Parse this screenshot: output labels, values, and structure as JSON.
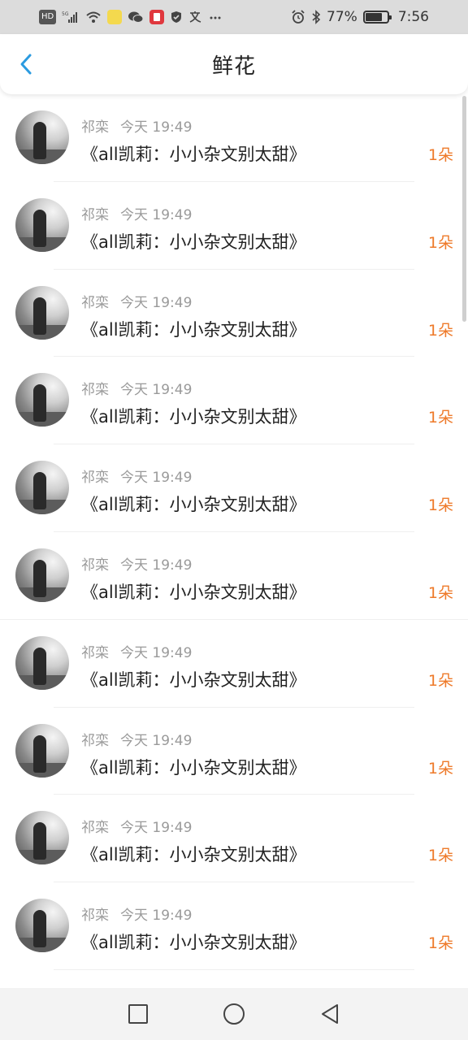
{
  "status_bar": {
    "hd_label": "HD",
    "network_label": "5G",
    "battery_percent": "77%",
    "battery_level": 0.77,
    "time": "7:56",
    "icons": [
      "hd-icon",
      "signal-icon",
      "wifi-icon",
      "app-icon",
      "wechat-icon",
      "app-icon",
      "shield-icon",
      "translate-icon",
      "more-icon",
      "alarm-icon",
      "bluetooth-icon",
      "battery-icon"
    ]
  },
  "header": {
    "title": "鲜花",
    "back_icon": "chevron-left-icon",
    "accent_color": "#2b9be0"
  },
  "list": {
    "items": [
      {
        "user": "祁栾",
        "time": "今天 19:49",
        "book": "《all凯莉：小小杂文别太甜》",
        "count": "1朵"
      },
      {
        "user": "祁栾",
        "time": "今天 19:49",
        "book": "《all凯莉：小小杂文别太甜》",
        "count": "1朵"
      },
      {
        "user": "祁栾",
        "time": "今天 19:49",
        "book": "《all凯莉：小小杂文别太甜》",
        "count": "1朵"
      },
      {
        "user": "祁栾",
        "time": "今天 19:49",
        "book": "《all凯莉：小小杂文别太甜》",
        "count": "1朵"
      },
      {
        "user": "祁栾",
        "time": "今天 19:49",
        "book": "《all凯莉：小小杂文别太甜》",
        "count": "1朵"
      },
      {
        "user": "祁栾",
        "time": "今天 19:49",
        "book": "《all凯莉：小小杂文别太甜》",
        "count": "1朵"
      },
      {
        "user": "祁栾",
        "time": "今天 19:49",
        "book": "《all凯莉：小小杂文别太甜》",
        "count": "1朵"
      },
      {
        "user": "祁栾",
        "time": "今天 19:49",
        "book": "《all凯莉：小小杂文别太甜》",
        "count": "1朵"
      },
      {
        "user": "祁栾",
        "time": "今天 19:49",
        "book": "《all凯莉：小小杂文别太甜》",
        "count": "1朵"
      },
      {
        "user": "祁栾",
        "time": "今天 19:49",
        "book": "《all凯莉：小小杂文别太甜》",
        "count": "1朵"
      }
    ],
    "count_color": "#ee7a2a"
  },
  "nav_bar": {
    "icons": [
      "square-icon",
      "circle-icon",
      "triangle-back-icon"
    ]
  }
}
